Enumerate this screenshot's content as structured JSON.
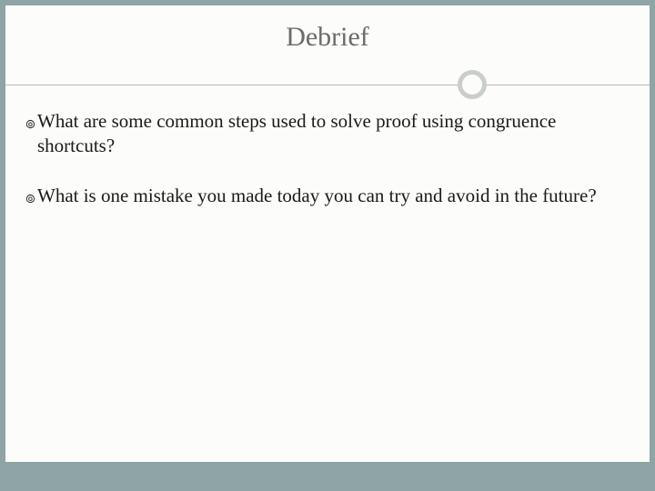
{
  "slide": {
    "title": "Debrief",
    "bullets": [
      "What are some common steps used to solve proof using congruence shortcuts?",
      "What is one mistake you made today you can try and avoid in the future?"
    ],
    "bullet_glyph": "๏"
  },
  "theme": {
    "background": "#8fa4a4",
    "surface": "#fcfcfa",
    "title_color": "#6b6b6b",
    "text_color": "#1a1a1a",
    "divider_color": "#b8b8b0",
    "accent_ring": "#c9cec9"
  }
}
